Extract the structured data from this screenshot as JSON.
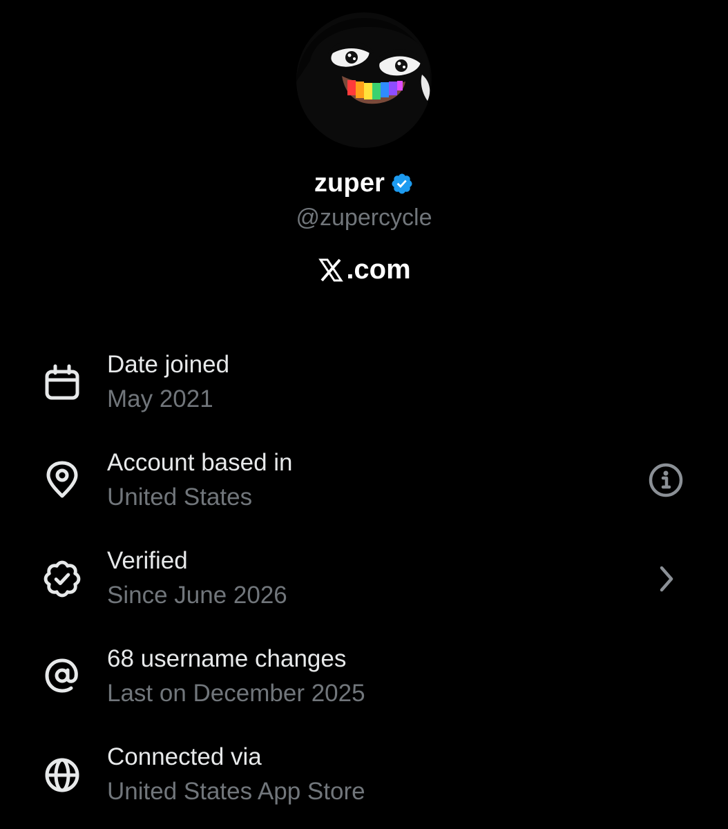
{
  "profile": {
    "display_name": "zuper",
    "handle": "@zupercycle",
    "site": ".com",
    "avatar_icon": "cartoon-frog-avatar",
    "verified_color": "#1d9bf0"
  },
  "rows": [
    {
      "icon": "calendar-icon",
      "title": "Date joined",
      "subtitle": "May 2021",
      "action": ""
    },
    {
      "icon": "location-pin-icon",
      "title": "Account based in",
      "subtitle": "United States",
      "action": "info-icon"
    },
    {
      "icon": "verified-badge-icon",
      "title": "Verified",
      "subtitle": "Since June 2026",
      "action": "chevron-right-icon"
    },
    {
      "icon": "at-sign-icon",
      "title": "68 username changes",
      "subtitle": "Last on December 2025",
      "action": ""
    },
    {
      "icon": "globe-icon",
      "title": "Connected via",
      "subtitle": "United States App Store",
      "action": ""
    }
  ],
  "colors": {
    "background": "#000000",
    "primary_text": "#e7e9ea",
    "secondary_text": "#71767b",
    "accent": "#1d9bf0"
  }
}
